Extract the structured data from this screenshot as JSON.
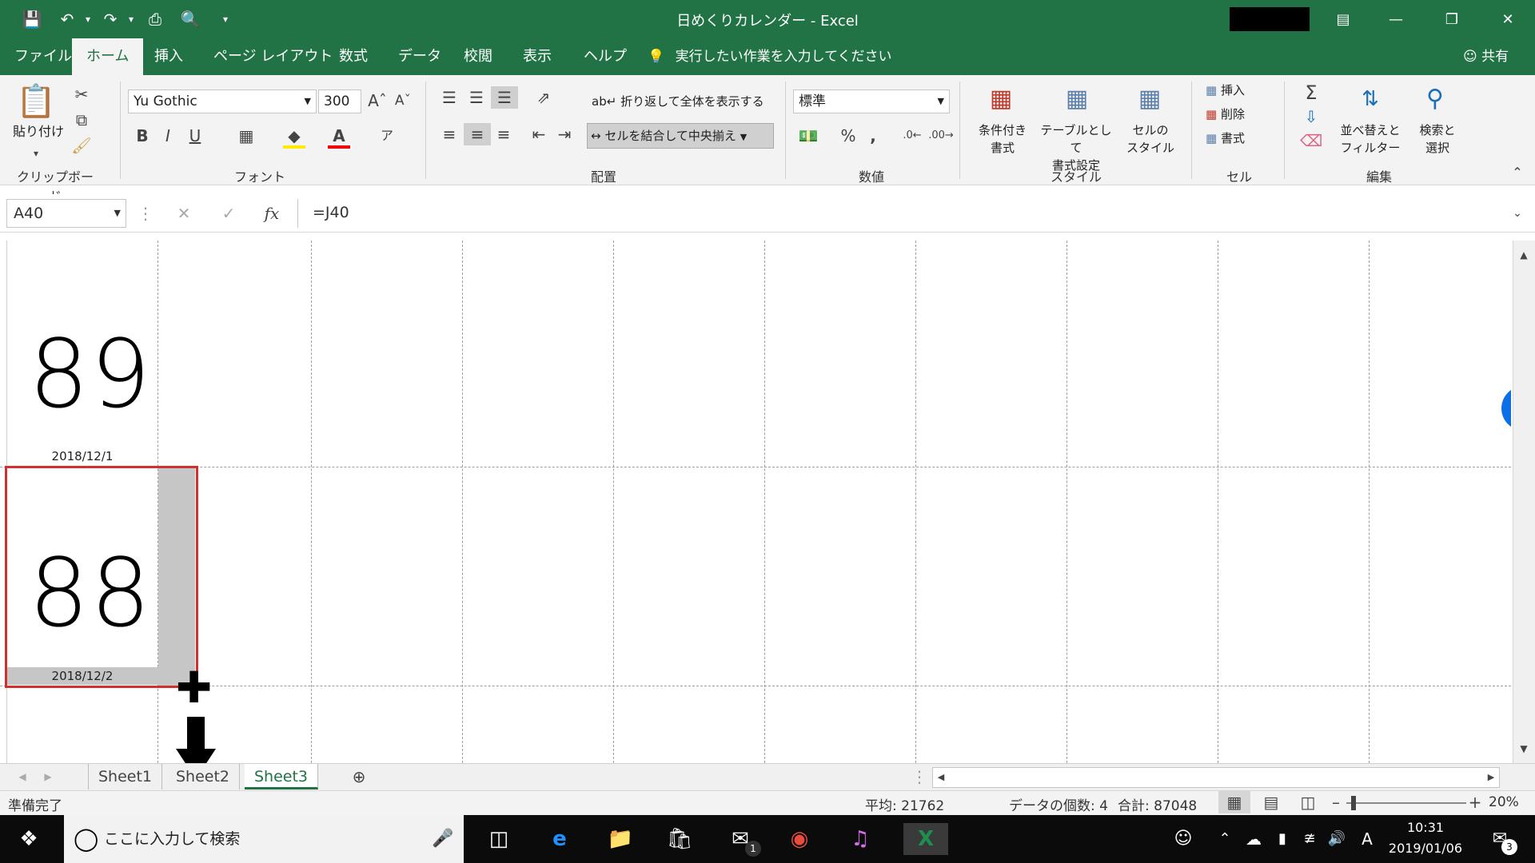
{
  "window": {
    "title": "日めくりカレンダー - Excel"
  },
  "ribbon_tabs": [
    "ファイル",
    "ホーム",
    "挿入",
    "ページ レイアウト",
    "数式",
    "データ",
    "校閲",
    "表示",
    "ヘルプ"
  ],
  "active_tab": "ホーム",
  "tell_me": "実行したい作業を入力してください",
  "share_label": "共有",
  "clipboard": {
    "paste": "貼り付け",
    "group": "クリップボード"
  },
  "font": {
    "name": "Yu Gothic",
    "size": "300",
    "group": "フォント"
  },
  "alignment": {
    "wrap": "折り返して全体を表示する",
    "merge": "セルを結合して中央揃え",
    "group": "配置"
  },
  "number": {
    "format": "標準",
    "group": "数値"
  },
  "styles": {
    "conditional": [
      "条件付き",
      "書式"
    ],
    "table": [
      "テーブルとして",
      "書式設定"
    ],
    "cell_styles": [
      "セルの",
      "スタイル"
    ],
    "group": "スタイル"
  },
  "cells": {
    "insert": "挿入",
    "delete": "削除",
    "format": "書式",
    "group": "セル"
  },
  "editing": {
    "sort": [
      "並べ替えと",
      "フィルター"
    ],
    "find": [
      "検索と",
      "選択"
    ],
    "group": "編集"
  },
  "formula_bar": {
    "name_box": "A40",
    "formula": "=J40"
  },
  "sheet_cells": [
    {
      "number": "89",
      "date": "2018/12/1"
    },
    {
      "number": "88",
      "date": "2018/12/2"
    }
  ],
  "sheets": [
    "Sheet1",
    "Sheet2",
    "Sheet3"
  ],
  "active_sheet": "Sheet3",
  "status": {
    "ready": "準備完了",
    "average": "平均: 21762",
    "count": "データの個数: 4",
    "sum": "合計: 87048",
    "zoom": "20%"
  },
  "taskbar": {
    "search_placeholder": "ここに入力して検索",
    "time": "10:31",
    "date": "2019/01/06",
    "mail_badge": "1",
    "notif_badge": "3"
  },
  "colors": {
    "excel_green": "#217346",
    "selection_red": "#d32f2f"
  }
}
